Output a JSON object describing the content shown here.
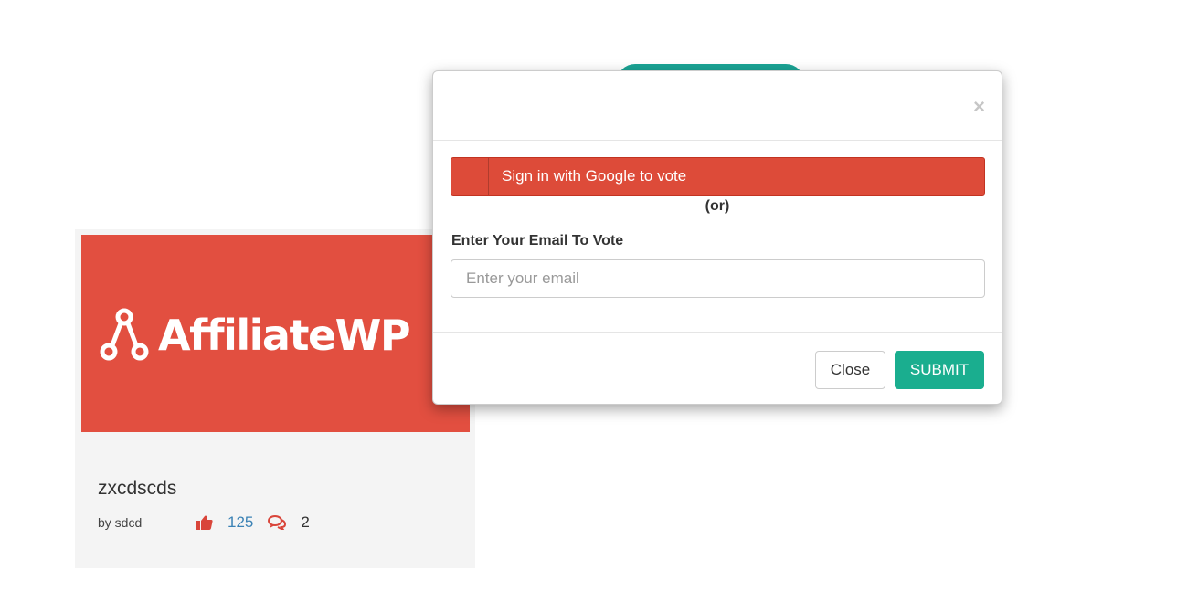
{
  "card": {
    "logo_text": "AffiliateWP",
    "title": "zxcdscds",
    "author": "by sdcd",
    "votes": "125",
    "comments": "2",
    "icons": {
      "votes": "thumbs-up-icon",
      "comments": "comments-icon"
    },
    "colors": {
      "image_bg": "#e24f40",
      "vote_icon": "#d9453a",
      "vote_count": "#3b82b5"
    }
  },
  "modal": {
    "close_symbol": "×",
    "google_button": "Sign in with Google to vote",
    "or_text": "(or)",
    "email_label": "Enter Your Email To Vote",
    "email_placeholder": "Enter your email",
    "email_value": "",
    "close_button": "Close",
    "submit_button": "SUBMIT",
    "colors": {
      "google": "#dd4b39",
      "submit": "#1aae8f"
    }
  }
}
